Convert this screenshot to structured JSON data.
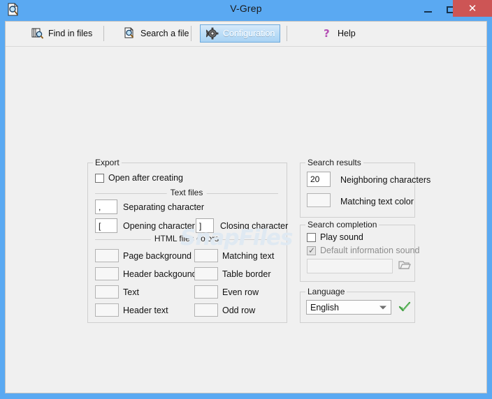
{
  "window": {
    "title": "V-Grep",
    "app_icon": "document-search-icon",
    "controls": {
      "minimize": "minimize-icon",
      "maximize": "maximize-icon",
      "close": "close-icon",
      "close_glyph": "✕"
    }
  },
  "toolbar": {
    "items": [
      {
        "label": "Find in files",
        "icon": "find-in-files-icon",
        "selected": false
      },
      {
        "label": "Search a file",
        "icon": "search-file-icon",
        "selected": false
      },
      {
        "label": "Configuration",
        "icon": "gear-icon",
        "selected": true
      },
      {
        "label": "Help",
        "icon": "question-mark-icon",
        "selected": false
      }
    ]
  },
  "watermark": "SnapFiles",
  "export": {
    "legend": "Export",
    "open_after_creating": {
      "label": "Open after creating",
      "checked": false
    },
    "text_files": {
      "legend": "Text files",
      "separating": {
        "label": "Separating character",
        "value": ","
      },
      "opening": {
        "label": "Opening character",
        "value": "["
      },
      "closing": {
        "label": "Closing character",
        "value": "]"
      }
    },
    "html_colors": {
      "legend": "HTML files colors",
      "left": [
        {
          "label": "Page background",
          "color": "#f7f7f7"
        },
        {
          "label": "Header backgound",
          "color": "#f7f7f7"
        },
        {
          "label": "Text",
          "color": "#f7f7f7"
        },
        {
          "label": "Header text",
          "color": "#f7f7f7"
        }
      ],
      "right": [
        {
          "label": "Matching text",
          "color": "#f7f7f7"
        },
        {
          "label": "Table border",
          "color": "#f7f7f7"
        },
        {
          "label": "Even row",
          "color": "#f7f7f7"
        },
        {
          "label": "Odd row",
          "color": "#f7f7f7"
        }
      ]
    }
  },
  "search_results": {
    "legend": "Search results",
    "neighboring": {
      "label": "Neighboring characters",
      "value": "20"
    },
    "matching_color": {
      "label": "Matching text color",
      "color": "#f7f7f7"
    }
  },
  "search_completion": {
    "legend": "Search completion",
    "play_sound": {
      "label": "Play sound",
      "checked": false
    },
    "default_sound": {
      "label": "Default information sound",
      "checked": true,
      "disabled": true
    },
    "sound_path": {
      "value": "",
      "placeholder": "",
      "disabled": true
    },
    "browse_icon": "open-folder-icon"
  },
  "language": {
    "legend": "Language",
    "selected": "English",
    "options": [
      "English"
    ],
    "confirm_icon": "green-check-icon"
  },
  "colors": {
    "titlebar": "#5aa9f2",
    "close_button": "#cd5555",
    "client_bg": "#f0f0f0",
    "selected_tab_border": "#6ca9dc",
    "watermark": "#dfe9f2"
  }
}
